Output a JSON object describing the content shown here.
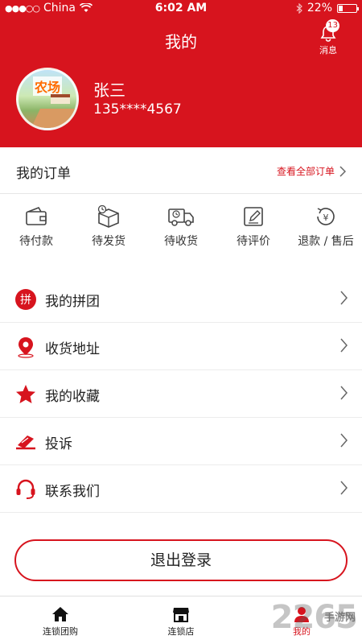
{
  "status_bar": {
    "signal_dots": "●●●○○",
    "carrier": "China",
    "time": "6:02 AM",
    "battery_percent": "22%",
    "battery_level": 0.22
  },
  "header": {
    "title": "我的",
    "messages_label": "消息",
    "messages_badge": "13"
  },
  "avatar": {
    "text": "农场"
  },
  "profile": {
    "name": "张三",
    "phone": "135****4567"
  },
  "orders": {
    "title": "我的订单",
    "view_all": "查看全部订单",
    "items": [
      {
        "label": "待付款",
        "icon": "wallet-icon"
      },
      {
        "label": "待发货",
        "icon": "package-icon"
      },
      {
        "label": "待收货",
        "icon": "truck-icon"
      },
      {
        "label": "待评价",
        "icon": "review-icon"
      },
      {
        "label": "退款 / 售后",
        "icon": "refund-icon"
      }
    ]
  },
  "menu": [
    {
      "label": "我的拼团",
      "icon": "group-buy-icon",
      "icon_text": "拼"
    },
    {
      "label": "收货地址",
      "icon": "location-pin-icon"
    },
    {
      "label": "我的收藏",
      "icon": "star-icon"
    },
    {
      "label": "投诉",
      "icon": "complaint-icon"
    },
    {
      "label": "联系我们",
      "icon": "headset-icon"
    }
  ],
  "logout_label": "退出登录",
  "tabbar": [
    {
      "label": "连锁团购",
      "icon": "home-icon",
      "active": false
    },
    {
      "label": "连锁店",
      "icon": "store-icon",
      "active": false
    },
    {
      "label": "我的",
      "icon": "user-icon",
      "active": true
    }
  ],
  "watermark": {
    "text": "2265",
    "sub": "手游网"
  },
  "colors": {
    "brand_red": "#d7141e",
    "text": "#222222",
    "divider": "#e6e6e6"
  }
}
